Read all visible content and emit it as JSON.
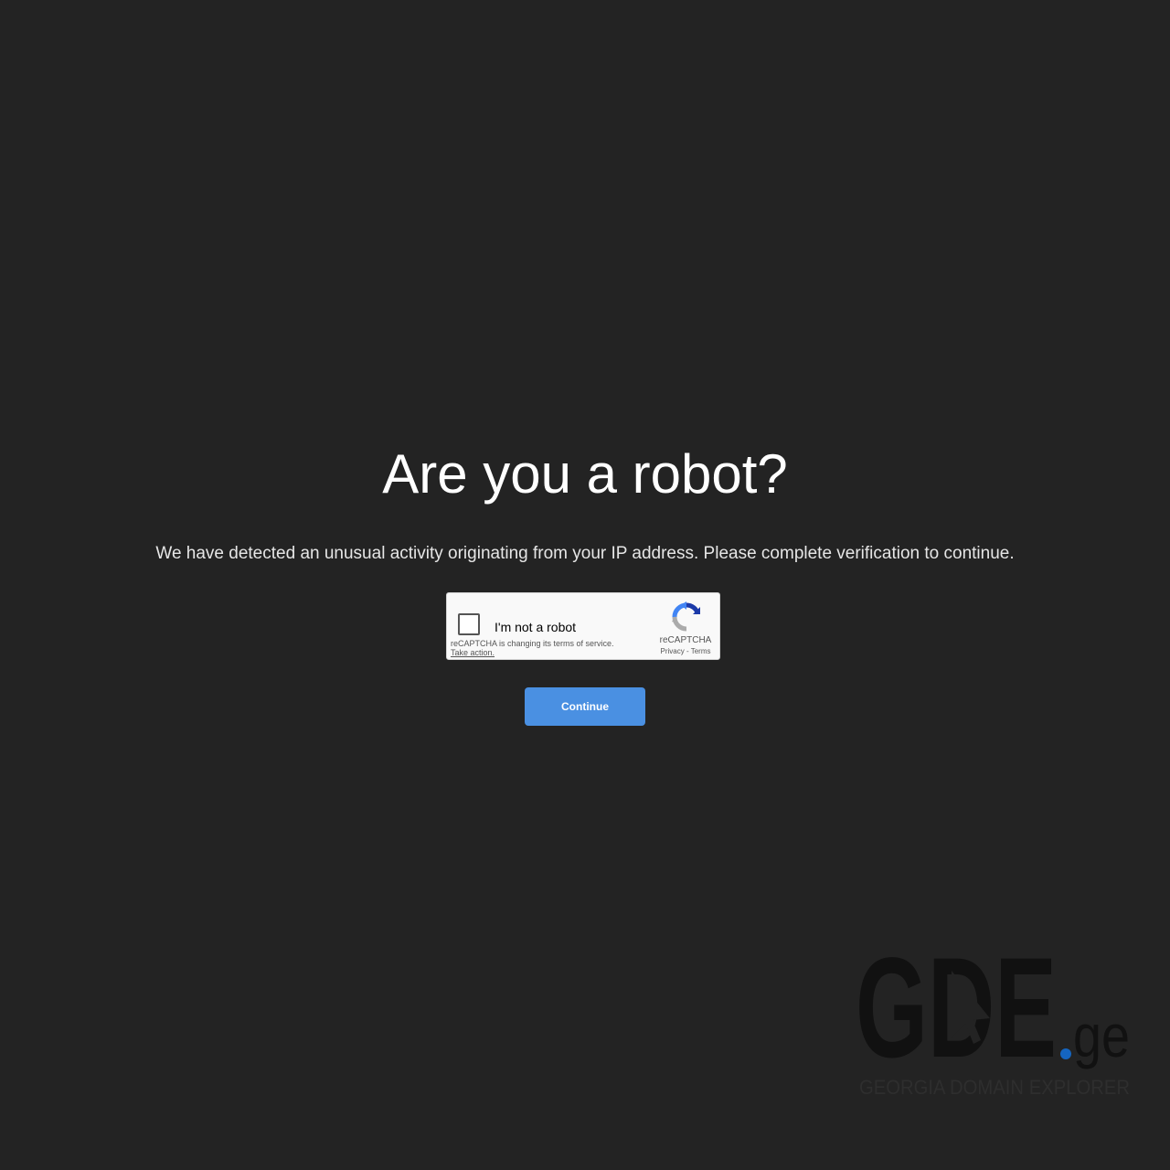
{
  "heading": "Are you a robot?",
  "message": "We have detected an unusual activity originating from your IP address. Please complete verification to continue.",
  "recaptcha": {
    "checkbox_label": "I'm not a robot",
    "notice": "reCAPTCHA is changing its terms of service.",
    "action_link": "Take action.",
    "brand": "reCAPTCHA",
    "privacy_link": "Privacy",
    "separator": "-",
    "terms_link": "Terms",
    "checked": false
  },
  "continue_button": {
    "label": "Continue",
    "color": "#4a90e2"
  },
  "logo": {
    "main_text": "GDE",
    "tld_text": "ge",
    "dot_color": "#1565c0",
    "tagline": "GEORGIA DOMAIN EXPLORER"
  },
  "colors": {
    "background": "#232323",
    "heading": "#ffffff",
    "message": "#e6e6e6",
    "logo_main": "#111111",
    "logo_tagline": "#2e2e2e"
  }
}
